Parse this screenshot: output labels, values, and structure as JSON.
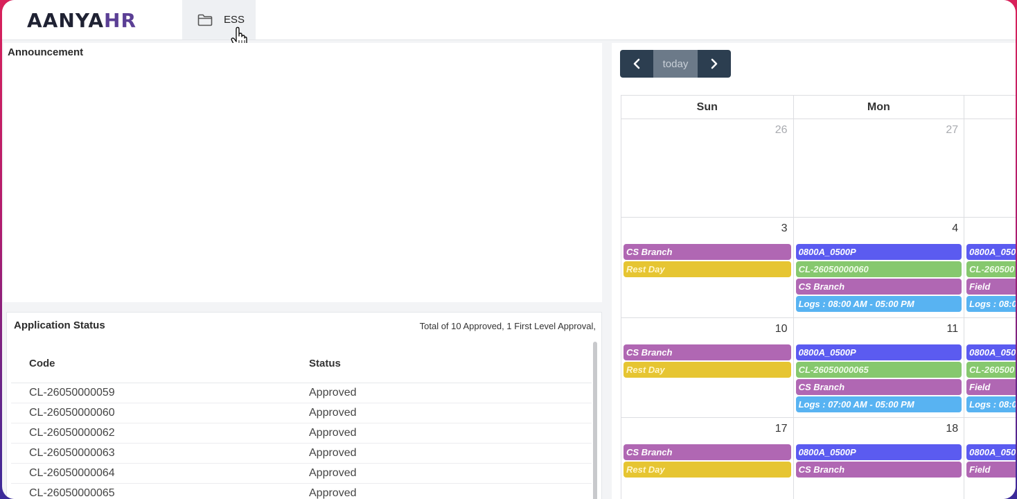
{
  "header": {
    "logo_main": "AANYA",
    "logo_accent": "HR",
    "ess_tab_label": "ESS"
  },
  "announcement": {
    "title": "Announcement"
  },
  "application_status": {
    "title": "Application Status",
    "summary": "Total of 10 Approved, 1 First Level Approval,",
    "columns": [
      "Code",
      "Status"
    ],
    "rows": [
      {
        "code": "CL-26050000059",
        "status": "Approved"
      },
      {
        "code": "CL-26050000060",
        "status": "Approved"
      },
      {
        "code": "CL-26050000062",
        "status": "Approved"
      },
      {
        "code": "CL-26050000063",
        "status": "Approved"
      },
      {
        "code": "CL-26050000064",
        "status": "Approved"
      },
      {
        "code": "CL-26050000065",
        "status": "Approved"
      }
    ]
  },
  "calendar": {
    "nav": {
      "prev": "‹",
      "today": "today",
      "next": "›"
    },
    "days": [
      "Sun",
      "Mon",
      ""
    ],
    "weeks": [
      {
        "cells": [
          {
            "num": "26",
            "other": true,
            "events": []
          },
          {
            "num": "27",
            "other": true,
            "events": []
          },
          {
            "num": "",
            "other": true,
            "events": []
          }
        ]
      },
      {
        "cells": [
          {
            "num": "3",
            "events": [
              {
                "text": "CS Branch",
                "color": "purple"
              },
              {
                "text": "Rest Day",
                "color": "yellow"
              }
            ]
          },
          {
            "num": "4",
            "events": [
              {
                "text": "0800A_0500P",
                "color": "blue"
              },
              {
                "text": "CL-26050000060",
                "color": "green"
              },
              {
                "text": "CS Branch",
                "color": "purple"
              },
              {
                "text": "Logs : 08:00 AM - 05:00 PM",
                "color": "lblue"
              }
            ]
          },
          {
            "num": "",
            "events": [
              {
                "text": "0800A_050",
                "color": "blue"
              },
              {
                "text": "CL-260500",
                "color": "green"
              },
              {
                "text": "Field",
                "color": "purple"
              },
              {
                "text": "Logs : 08:0",
                "color": "lblue"
              }
            ]
          }
        ]
      },
      {
        "cells": [
          {
            "num": "10",
            "events": [
              {
                "text": "CS Branch",
                "color": "purple"
              },
              {
                "text": "Rest Day",
                "color": "yellow"
              }
            ]
          },
          {
            "num": "11",
            "events": [
              {
                "text": "0800A_0500P",
                "color": "blue"
              },
              {
                "text": "CL-26050000065",
                "color": "green"
              },
              {
                "text": "CS Branch",
                "color": "purple"
              },
              {
                "text": "Logs : 07:00 AM - 05:00 PM",
                "color": "lblue"
              }
            ]
          },
          {
            "num": "",
            "events": [
              {
                "text": "0800A_050",
                "color": "blue"
              },
              {
                "text": "CL-260500",
                "color": "green"
              },
              {
                "text": "Field",
                "color": "purple"
              },
              {
                "text": "Logs : 08:0",
                "color": "lblue"
              }
            ]
          }
        ]
      },
      {
        "cells": [
          {
            "num": "17",
            "events": [
              {
                "text": "CS Branch",
                "color": "purple"
              },
              {
                "text": "Rest Day",
                "color": "yellow"
              }
            ]
          },
          {
            "num": "18",
            "events": [
              {
                "text": "0800A_0500P",
                "color": "blue"
              },
              {
                "text": "CS Branch",
                "color": "purple"
              }
            ]
          },
          {
            "num": "",
            "events": [
              {
                "text": "0800A_050",
                "color": "blue"
              },
              {
                "text": "Field",
                "color": "purple"
              }
            ]
          }
        ]
      }
    ]
  }
}
